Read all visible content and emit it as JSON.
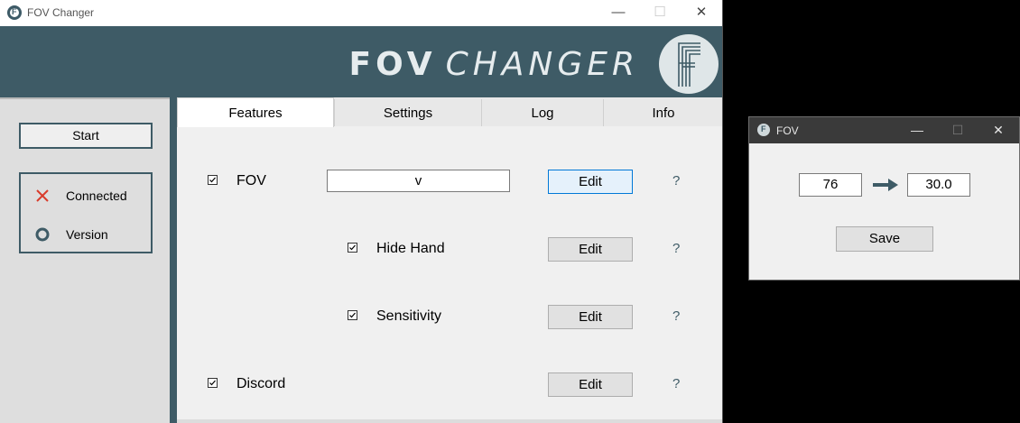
{
  "window": {
    "title": "FOV Changer",
    "controls": {
      "minimize": "—",
      "maximize": "☐",
      "close": "✕"
    }
  },
  "banner": {
    "brand_bold": "FOV",
    "brand_light": "CHANGER"
  },
  "sidebar": {
    "start_label": "Start",
    "status": [
      {
        "icon": "x-icon",
        "label": "Connected",
        "color": "#d93b2b"
      },
      {
        "icon": "circle-icon",
        "label": "Version",
        "color": "#3e5b66"
      }
    ]
  },
  "tabs": [
    {
      "label": "Features",
      "active": true
    },
    {
      "label": "Settings",
      "active": false
    },
    {
      "label": "Log",
      "active": false
    },
    {
      "label": "Info",
      "active": false
    }
  ],
  "features": [
    {
      "label": "FOV",
      "checked": true,
      "key_value": "v",
      "edit_label": "Edit",
      "help": "?"
    },
    {
      "label": "Hide Hand",
      "checked": true,
      "edit_label": "Edit",
      "help": "?"
    },
    {
      "label": "Sensitivity",
      "checked": true,
      "edit_label": "Edit",
      "help": "?"
    },
    {
      "label": "Discord",
      "checked": true,
      "edit_label": "Edit",
      "help": "?"
    }
  ],
  "fov_popup": {
    "title": "FOV",
    "from_value": "76",
    "to_value": "30.0",
    "save_label": "Save",
    "controls": {
      "minimize": "—",
      "maximize": "☐",
      "close": "✕"
    }
  },
  "colors": {
    "accent": "#3e5b66",
    "error": "#d93b2b",
    "background": "#000000"
  }
}
